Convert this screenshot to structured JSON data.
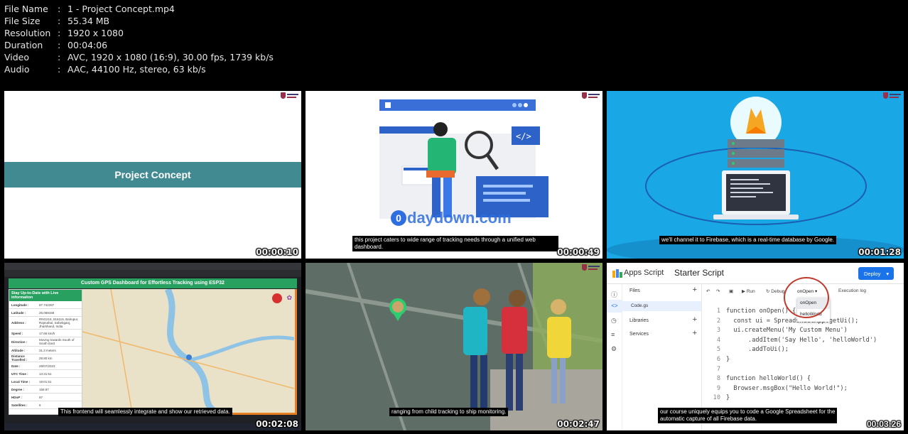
{
  "info": [
    {
      "key": "File Name",
      "value": "1 - Project Concept.mp4"
    },
    {
      "key": "File Size",
      "value": "55.34 MB"
    },
    {
      "key": "Resolution",
      "value": "1920 x 1080"
    },
    {
      "key": "Duration",
      "value": "00:04:06"
    },
    {
      "key": "Video",
      "value": "AVC, 1920 x 1080 (16:9), 30.00 fps, 1739 kb/s"
    },
    {
      "key": "Audio",
      "value": "AAC, 44100 Hz, stereo, 63 kb/s"
    }
  ],
  "thumbs": {
    "t1": {
      "timestamp": "00:00:10",
      "title": "Project Concept"
    },
    "t2": {
      "timestamp": "00:00:49",
      "subtitle": "this project caters to wide range of tracking needs through a unified web dashboard.",
      "watermark_letter": "0",
      "watermark": "daydown.com"
    },
    "t3": {
      "timestamp": "00:01:28",
      "subtitle": "we'll channel it to Firebase, which is a real-time database by Google."
    },
    "t4": {
      "timestamp": "00:02:08",
      "subtitle": "This frontend will seamlessly integrate and show our retrieved data.",
      "dashboard_title": "Custom GPS Dashboard for Effortless Tracking using ESP32",
      "panel_header": "Stay Up-to-Date with Live information",
      "rows": [
        {
          "k": "Longitude :",
          "v": "87.742287"
        },
        {
          "k": "Latitude :",
          "v": "25.069158"
        },
        {
          "k": "Address :",
          "v": "RNG216, 816116, Balrupur, Rajmahal, Sahebganj, Jharkhand, India"
        },
        {
          "k": "Speed :",
          "v": "17.65 km/h"
        },
        {
          "k": "Direction :",
          "v": "Moving towards South of South East"
        },
        {
          "k": "Altitude :",
          "v": "31.3 meters"
        },
        {
          "k": "Distance Travelled :",
          "v": "28.80 km"
        },
        {
          "k": "Date :",
          "v": "28/07/2023"
        },
        {
          "k": "UTC Time :",
          "v": "13:31:51"
        },
        {
          "k": "Local Time :",
          "v": "19:01:51"
        },
        {
          "k": "Degree :",
          "v": "158.97"
        },
        {
          "k": "HDoP :",
          "v": "97"
        },
        {
          "k": "Satellites :",
          "v": "6"
        }
      ]
    },
    "t5": {
      "timestamp": "00:02:47",
      "subtitle": "ranging from child tracking to ship monitoring."
    },
    "t6": {
      "timestamp": "00:03:26",
      "subtitle_line1": "our course uniquely equips you to code a Google Spreadsheet for the",
      "subtitle_line2": "automatic capture of all Firebase data.",
      "app_name": "Apps Script",
      "project": "Starter Script",
      "deploy": "Deploy",
      "files": "Files",
      "code_file": "Code.gs",
      "libraries": "Libraries",
      "services": "Services",
      "run": "Run",
      "debug": "Debug",
      "function_select": "onOpen",
      "exec_log": "Execution log",
      "menu": [
        "onOpen",
        "helloWorld"
      ],
      "code_lines": [
        {
          "n": "1",
          "t": "function onOpen() {"
        },
        {
          "n": "2",
          "t": "  const ui = SpreadsheetApp.getUi();"
        },
        {
          "n": "3",
          "t": "  ui.createMenu('My Custom Menu')"
        },
        {
          "n": "4",
          "t": "      .addItem('Say Hello', 'helloWorld')"
        },
        {
          "n": "5",
          "t": "      .addToUi();"
        },
        {
          "n": "6",
          "t": "}"
        },
        {
          "n": "7",
          "t": ""
        },
        {
          "n": "8",
          "t": "function helloWorld() {"
        },
        {
          "n": "9",
          "t": "  Browser.msgBox(\"Hello World!\");"
        },
        {
          "n": "10",
          "t": "}"
        }
      ]
    }
  }
}
